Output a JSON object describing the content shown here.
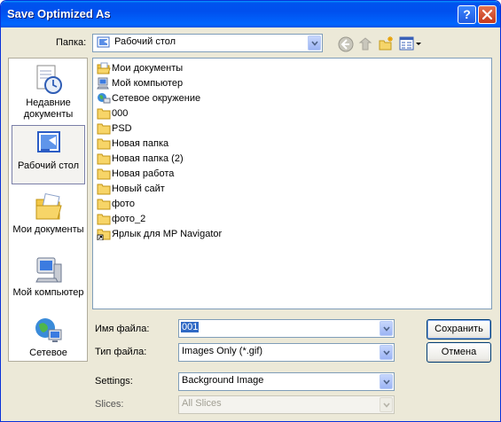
{
  "window": {
    "title": "Save Optimized As"
  },
  "lookin": {
    "label": "Папка:",
    "value": "Рабочий стол"
  },
  "places": [
    {
      "label": "Недавние документы",
      "icon": "recent-documents-icon"
    },
    {
      "label": "Рабочий стол",
      "icon": "desktop-icon"
    },
    {
      "label": "Мои документы",
      "icon": "my-documents-icon"
    },
    {
      "label": "Мой компьютер",
      "icon": "my-computer-icon"
    },
    {
      "label": "Сетевое",
      "icon": "network-icon"
    }
  ],
  "files": [
    {
      "name": "Мои документы",
      "icon": "my-documents-icon"
    },
    {
      "name": "Мой компьютер",
      "icon": "my-computer-icon"
    },
    {
      "name": "Сетевое окружение",
      "icon": "network-icon"
    },
    {
      "name": "000",
      "icon": "folder-icon"
    },
    {
      "name": "PSD",
      "icon": "folder-icon"
    },
    {
      "name": "Новая папка",
      "icon": "folder-icon"
    },
    {
      "name": "Новая папка (2)",
      "icon": "folder-icon"
    },
    {
      "name": "Новая работа",
      "icon": "folder-icon"
    },
    {
      "name": "Новый сайт",
      "icon": "folder-icon"
    },
    {
      "name": "фото",
      "icon": "folder-icon"
    },
    {
      "name": "фото_2",
      "icon": "folder-icon"
    },
    {
      "name": "Ярлык для MP Navigator",
      "icon": "shortcut-icon"
    }
  ],
  "filename": {
    "label": "Имя файла:",
    "value": "001"
  },
  "filetype": {
    "label": "Тип файла:",
    "value": "Images Only (*.gif)"
  },
  "settings": {
    "label": "Settings:",
    "value": "Background Image"
  },
  "slices": {
    "label": "Slices:",
    "value": "All Slices"
  },
  "buttons": {
    "save": "Сохранить",
    "cancel": "Отмена"
  }
}
